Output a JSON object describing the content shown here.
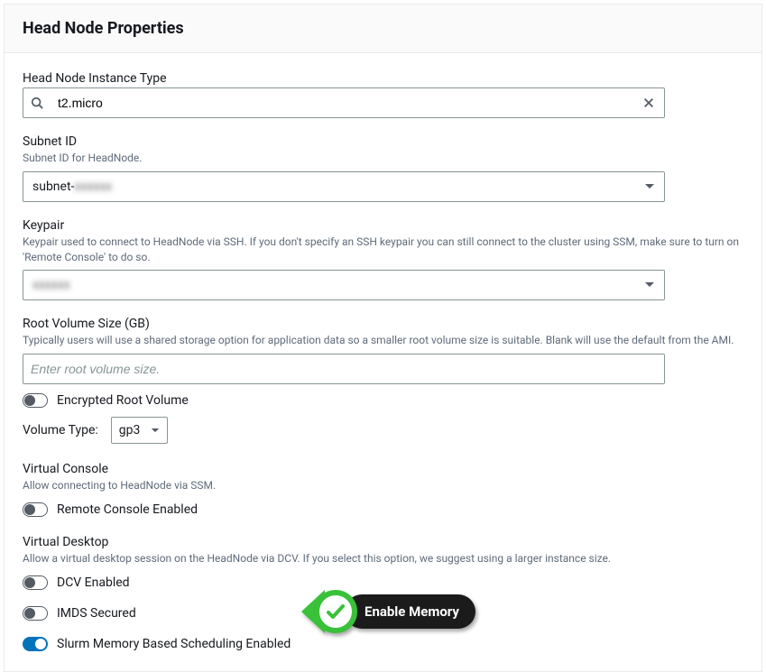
{
  "panel": {
    "title": "Head Node Properties"
  },
  "instanceType": {
    "label": "Head Node Instance Type",
    "value": "t2.micro"
  },
  "subnet": {
    "label": "Subnet ID",
    "desc": "Subnet ID for HeadNode.",
    "value": "subnet-",
    "hiddenSuffix": "xxxxxx"
  },
  "keypair": {
    "label": "Keypair",
    "desc": "Keypair used to connect to HeadNode via SSH. If you don't specify an SSH keypair you can still connect to the cluster using SSM, make sure to turn on 'Remote Console' to do so.",
    "hiddenValue": "xxxxxx"
  },
  "rootVolume": {
    "label": "Root Volume Size (GB)",
    "desc": "Typically users will use a shared storage option for application data so a smaller root volume size is suitable. Blank will use the default from the AMI.",
    "placeholder": "Enter root volume size."
  },
  "encrypted": {
    "label": "Encrypted Root Volume",
    "on": false
  },
  "volumeType": {
    "label": "Volume Type:",
    "value": "gp3"
  },
  "virtualConsole": {
    "label": "Virtual Console",
    "desc": "Allow connecting to HeadNode via SSM.",
    "toggleLabel": "Remote Console Enabled",
    "on": false
  },
  "virtualDesktop": {
    "label": "Virtual Desktop",
    "desc": "Allow a virtual desktop session on the HeadNode via DCV. If you select this option, we suggest using a larger instance size.",
    "toggleLabel": "DCV Enabled",
    "on": false
  },
  "imds": {
    "label": "IMDS Secured",
    "on": false
  },
  "slurm": {
    "label": "Slurm Memory Based Scheduling Enabled",
    "on": true
  },
  "callout": {
    "label": "Enable Memory"
  }
}
